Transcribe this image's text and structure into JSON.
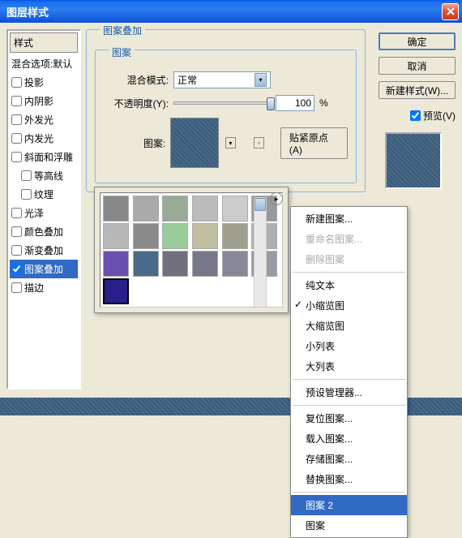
{
  "window": {
    "title": "图层样式"
  },
  "styles_panel": {
    "header": "样式",
    "blending_options": "混合选项:默认",
    "items": [
      {
        "label": "投影",
        "checked": false,
        "indent": false
      },
      {
        "label": "内阴影",
        "checked": false,
        "indent": false
      },
      {
        "label": "外发光",
        "checked": false,
        "indent": false
      },
      {
        "label": "内发光",
        "checked": false,
        "indent": false
      },
      {
        "label": "斜面和浮雕",
        "checked": false,
        "indent": false
      },
      {
        "label": "等高线",
        "checked": false,
        "indent": true
      },
      {
        "label": "纹理",
        "checked": false,
        "indent": true
      },
      {
        "label": "光泽",
        "checked": false,
        "indent": false
      },
      {
        "label": "颜色叠加",
        "checked": false,
        "indent": false
      },
      {
        "label": "渐变叠加",
        "checked": false,
        "indent": false
      },
      {
        "label": "图案叠加",
        "checked": true,
        "indent": false,
        "selected": true
      },
      {
        "label": "描边",
        "checked": false,
        "indent": false
      }
    ]
  },
  "pattern_overlay": {
    "title": "图案叠加",
    "subtitle": "图案",
    "blend_mode_label": "混合模式:",
    "blend_mode_value": "正常",
    "opacity_label": "不透明度(Y):",
    "opacity_value": "100",
    "opacity_unit": "%",
    "pattern_label": "图案:",
    "snap_button": "贴紧原点(A)"
  },
  "buttons": {
    "ok": "确定",
    "cancel": "取消",
    "new_style": "新建样式(W)...",
    "preview": "预览(V)"
  },
  "pattern_swatches": [
    "#888",
    "#aaa",
    "#9a9",
    "#bbb",
    "#ccc",
    "#999",
    "#b8b8b8",
    "#8a8a8a",
    "#9c9",
    "#c0c0a0",
    "#a0a090",
    "#b0b0b0",
    "#6a4fb0",
    "#4a6a8a",
    "#707080",
    "#778",
    "#889",
    "#99a",
    "#2a1f8a"
  ],
  "context_menu": {
    "new_pattern": "新建图案...",
    "rename_pattern": "重命名图案...",
    "delete_pattern": "删除图案",
    "text_only": "纯文本",
    "small_thumb": "小缩览图",
    "large_thumb": "大缩览图",
    "small_list": "小列表",
    "large_list": "大列表",
    "preset_manager": "预设管理器...",
    "reset_patterns": "复位图案...",
    "load_patterns": "载入图案...",
    "save_patterns": "存储图案...",
    "replace_patterns": "替换图案...",
    "pattern_2": "图案 2",
    "pattern": "图案"
  }
}
